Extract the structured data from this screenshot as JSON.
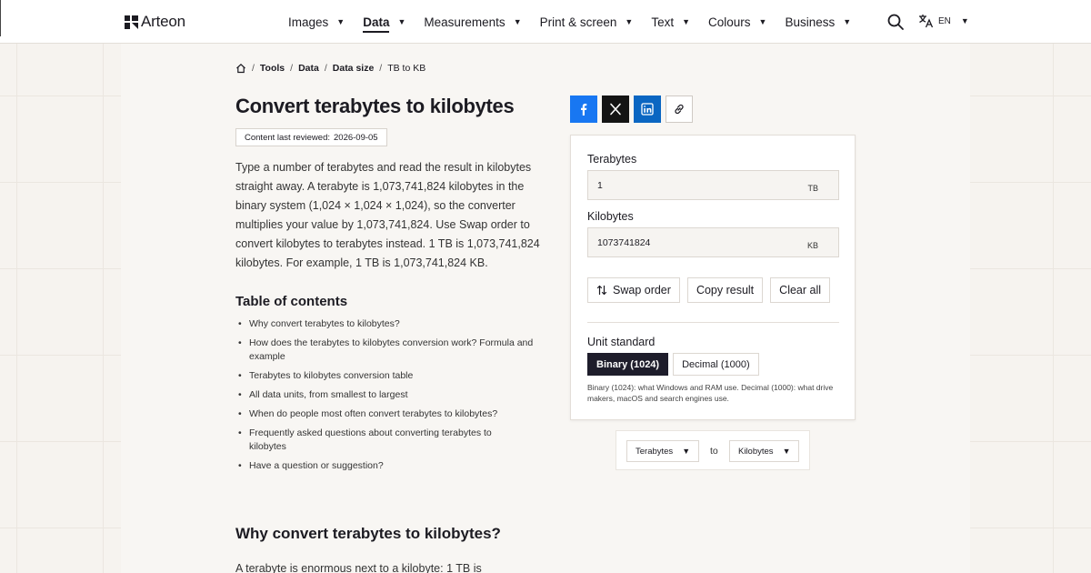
{
  "brand": {
    "name": "Arteon"
  },
  "nav": {
    "items": [
      {
        "label": "Images",
        "caret": "▼"
      },
      {
        "label": "Data",
        "caret": "▼"
      },
      {
        "label": "Measurements",
        "caret": "▼"
      },
      {
        "label": "Print & screen",
        "caret": "▼"
      },
      {
        "label": "Text",
        "caret": "▼"
      },
      {
        "label": "Colours",
        "caret": "▼"
      },
      {
        "label": "Business",
        "caret": "▼"
      }
    ],
    "active_item": "Data",
    "language": "EN",
    "language_caret": "▼"
  },
  "breadcrumb": {
    "items": [
      "Tools",
      "Data",
      "Data size",
      "TB to KB"
    ],
    "separator": "/"
  },
  "page": {
    "title": "Convert terabytes to kilobytes",
    "reviewed_label": "Content last reviewed:",
    "reviewed_date": "2026-09-05",
    "intro": "Type a number of terabytes and read the result in kilobytes straight away. A terabyte is 1,073,741,824 kilobytes in the binary system (1,024 × 1,024 × 1,024), so the converter multiplies your value by 1,073,741,824. Use Swap order to convert kilobytes to terabytes instead. 1 TB is 1,073,741,824 kilobytes. For example, 1 TB is 1,073,741,824 KB.",
    "toc_title": "Table of contents",
    "toc": [
      "Why convert terabytes to kilobytes?",
      "How does the terabytes to kilobytes conversion work? Formula and example",
      "Terabytes to kilobytes conversion table",
      "All data units, from smallest to largest",
      "When do people most often convert terabytes to kilobytes?",
      "Frequently asked questions about converting terabytes to kilobytes",
      "Have a question or suggestion?"
    ],
    "section_title": "Why convert terabytes to kilobytes?",
    "section_text": "A terabyte is enormous next to a kilobyte: 1 TB is"
  },
  "share": {
    "icons": [
      "facebook-icon",
      "x-icon",
      "linkedin-icon",
      "link-icon"
    ],
    "colors": {
      "facebook": "#1877f2",
      "x": "#141414",
      "linkedin": "#0a66c2"
    }
  },
  "converter": {
    "from_label": "Terabytes",
    "from_value": "1",
    "from_unit": "TB",
    "to_label": "Kilobytes",
    "to_value": "1073741824",
    "to_unit": "KB",
    "swap_label": "Swap order",
    "copy_label": "Copy result",
    "clear_label": "Clear all",
    "standard_label": "Unit standard",
    "binary_label": "Binary (1024)",
    "decimal_label": "Decimal (1000)",
    "selected_standard": "Binary (1024)",
    "standard_note": "Binary (1024): what Windows and RAM use. Decimal (1000): what drive makers, macOS and search engines use."
  },
  "unit_picker": {
    "from_unit": "Terabytes",
    "to_word": "to",
    "to_unit": "Kilobytes",
    "caret": "▼"
  },
  "colors": {
    "background": "#f6f3ef",
    "text": "#1c1b22",
    "active_standard": "#1e1d2b"
  }
}
